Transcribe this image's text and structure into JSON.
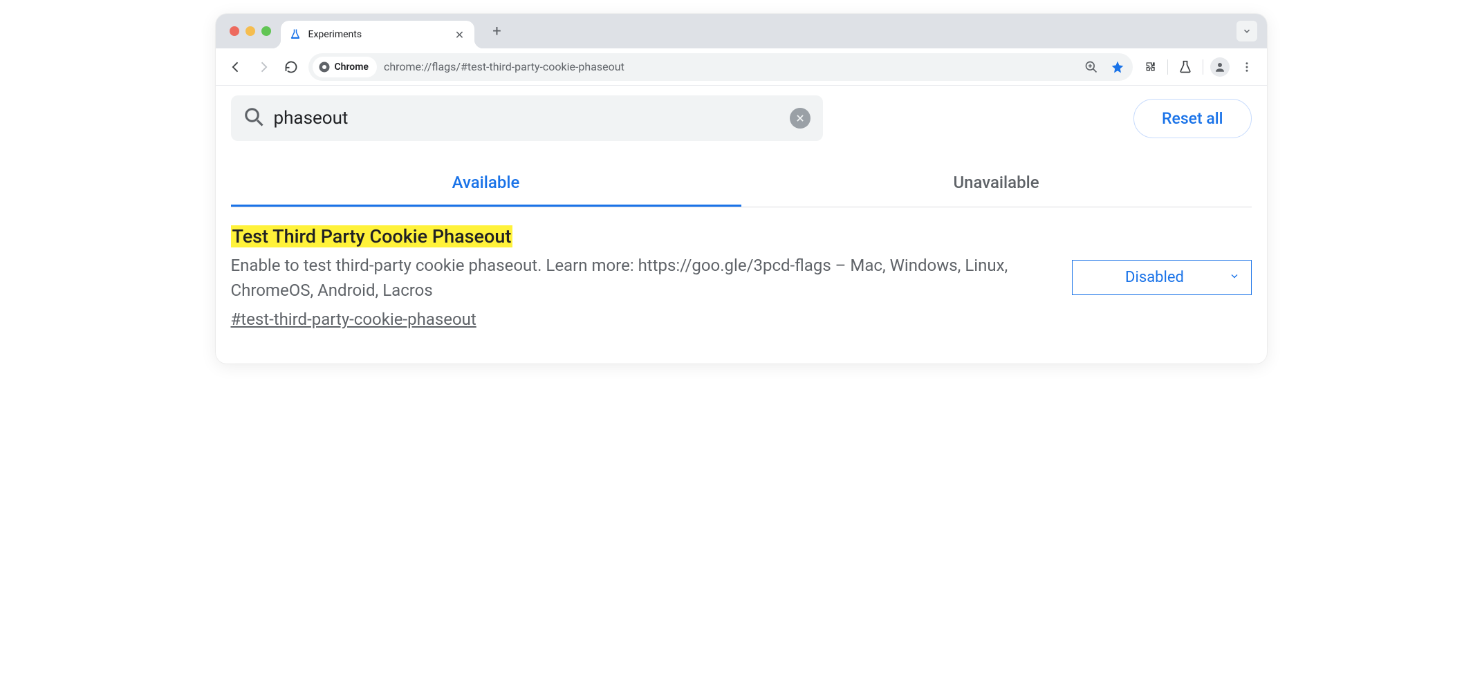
{
  "window": {
    "tab_title": "Experiments",
    "chrome_chip": "Chrome",
    "url": "chrome://flags/#test-third-party-cookie-phaseout"
  },
  "search": {
    "value": "phaseout",
    "reset_label": "Reset all"
  },
  "tabs": {
    "available": "Available",
    "unavailable": "Unavailable"
  },
  "result": {
    "title": "Test Third Party Cookie Phaseout",
    "description": "Enable to test third-party cookie phaseout. Learn more: https://goo.gle/3pcd-flags – Mac, Windows, Linux, ChromeOS, Android, Lacros",
    "hash": "#test-third-party-cookie-phaseout",
    "dropdown_value": "Disabled"
  }
}
